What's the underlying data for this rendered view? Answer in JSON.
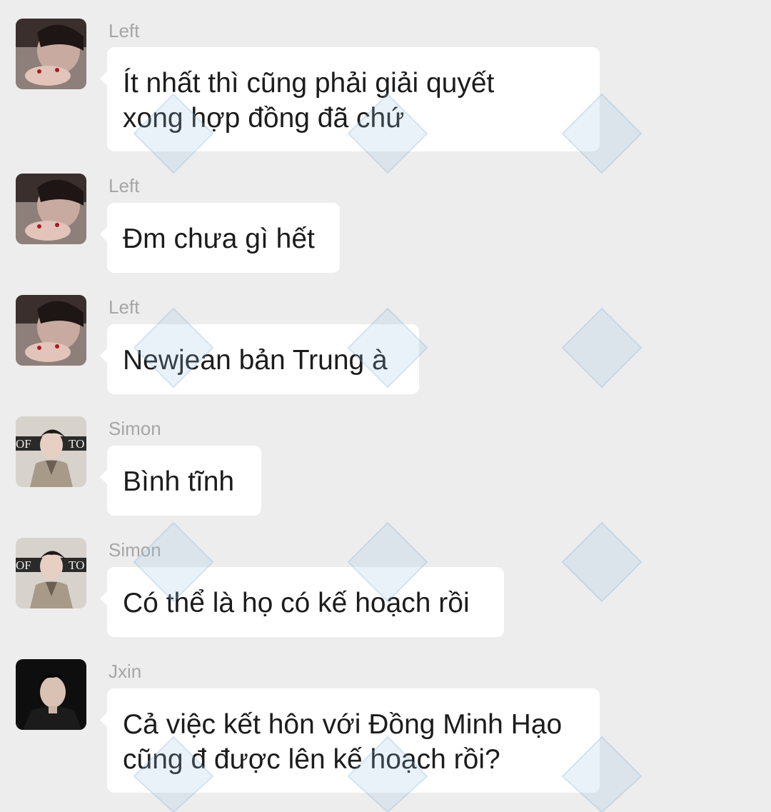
{
  "messages": [
    {
      "sender": "Left",
      "avatar_icon": "avatar-left",
      "text": "Ít nhất thì cũng phải giải quyết\nxong hợp đồng đã chứ"
    },
    {
      "sender": "Left",
      "avatar_icon": "avatar-left",
      "text": "Đm chưa gì hết"
    },
    {
      "sender": "Left",
      "avatar_icon": "avatar-left",
      "text": "Newjean bản Trung à"
    },
    {
      "sender": "Simon",
      "avatar_icon": "avatar-simon",
      "text": "Bình tĩnh"
    },
    {
      "sender": "Simon",
      "avatar_icon": "avatar-simon",
      "text": "Có thể là họ có kế hoạch rồi"
    },
    {
      "sender": "Jxin",
      "avatar_icon": "avatar-jxin",
      "text": "Cả việc kết hôn với Đồng Minh Hạo\ncũng đ được lên kế hoạch rồi?"
    }
  ],
  "colors": {
    "background": "#ededed",
    "bubble": "#ffffff",
    "sender_name": "#a6a6a6",
    "message_text": "#1c1c1c"
  }
}
